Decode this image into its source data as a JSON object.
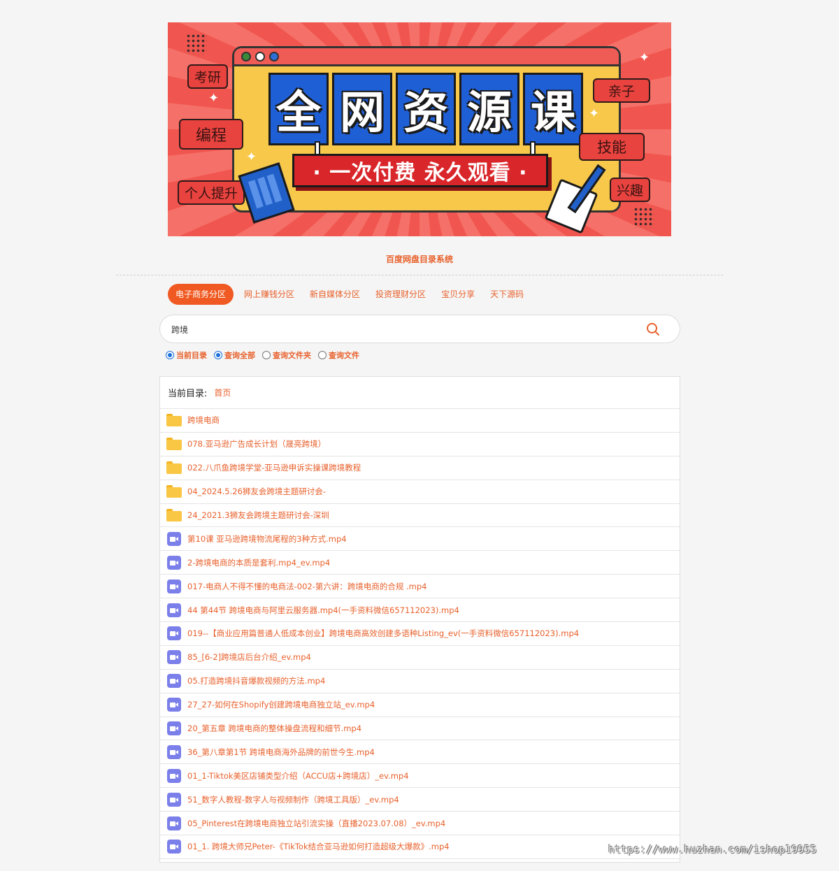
{
  "banner": {
    "title_chars": [
      "全",
      "网",
      "资",
      "源",
      "课"
    ],
    "slogan": "· 一次付费 永久观看 ·",
    "tags": {
      "kaoyan": "考研",
      "biancheng": "编程",
      "geren": "个人提升",
      "qinzi": "亲子",
      "jineng": "技能",
      "xingqu": "兴趣"
    }
  },
  "system_title": "百度网盘目录系统",
  "tabs": [
    {
      "label": "电子商务分区",
      "active": true
    },
    {
      "label": "网上赚钱分区",
      "active": false
    },
    {
      "label": "新自媒体分区",
      "active": false
    },
    {
      "label": "投资理财分区",
      "active": false
    },
    {
      "label": "宝贝分享",
      "active": false
    },
    {
      "label": "天下源码",
      "active": false
    }
  ],
  "search": {
    "value": "跨境",
    "icon": "search-icon"
  },
  "radios": [
    {
      "label": "当前目录",
      "checked": true
    },
    {
      "label": "查询全部",
      "checked": true
    },
    {
      "label": "查询文件夹",
      "checked": false
    },
    {
      "label": "查询文件",
      "checked": false
    }
  ],
  "panel": {
    "current_label": "当前目录:",
    "breadcrumb": "首页"
  },
  "items": [
    {
      "type": "folder",
      "name": "跨境电商"
    },
    {
      "type": "folder",
      "name": "078.亚马逊广告成长计划（晟亮跨境）"
    },
    {
      "type": "folder",
      "name": "022.八爪鱼跨境学堂-亚马逊申诉实操课跨境教程"
    },
    {
      "type": "folder",
      "name": "04_2024.5.26狮友会跨境主题研讨会-"
    },
    {
      "type": "folder",
      "name": "24_2021.3狮友会跨境主题研讨会-深圳"
    },
    {
      "type": "video",
      "name": "第10课 亚马逊跨境物流尾程的3种方式.mp4"
    },
    {
      "type": "video",
      "name": "2-跨境电商的本质是套利.mp4_ev.mp4"
    },
    {
      "type": "video",
      "name": "017-电商人不得不懂的电商法-002-第六讲：跨境电商的合规 .mp4"
    },
    {
      "type": "video",
      "name": "44 第44节 跨境电商与阿里云服务器.mp4(一手资料微信657112023).mp4"
    },
    {
      "type": "video",
      "name": "019--【商业应用篇普通人低成本创业】跨境电商高效创建多语种Listing_ev(一手资料微信657112023).mp4"
    },
    {
      "type": "video",
      "name": "85_[6-2]跨境店后台介绍_ev.mp4"
    },
    {
      "type": "video",
      "name": "05.打造跨境抖音爆款视频的方法.mp4"
    },
    {
      "type": "video",
      "name": "27_27-如何在Shopify创建跨境电商独立站_ev.mp4"
    },
    {
      "type": "video",
      "name": "20_第五章 跨境电商的整体操盘流程和细节.mp4"
    },
    {
      "type": "video",
      "name": "36_第八章第1节 跨境电商海外品牌的前世今生.mp4"
    },
    {
      "type": "video",
      "name": "01_1-Tiktok美区店铺类型介绍（ACCU店+跨境店）_ev.mp4"
    },
    {
      "type": "video",
      "name": "51_数字人教程-数字人与视频制作（跨境工具版）_ev.mp4"
    },
    {
      "type": "video",
      "name": "05_Pinterest在跨境电商独立站引流实操（直播2023.07.08）_ev.mp4"
    },
    {
      "type": "video",
      "name": "01_1. 跨境大师兄Peter-《TikTok结合亚马逊如何打造超级大爆款》.mp4"
    }
  ],
  "watermark": "https://www.huzhan.com/ishop19955",
  "colors": {
    "accent": "#e8612c",
    "tab_active": "#f05a22",
    "radio_checked": "#1a6fd9",
    "folder": "#fac745",
    "video": "#7b7fea"
  }
}
